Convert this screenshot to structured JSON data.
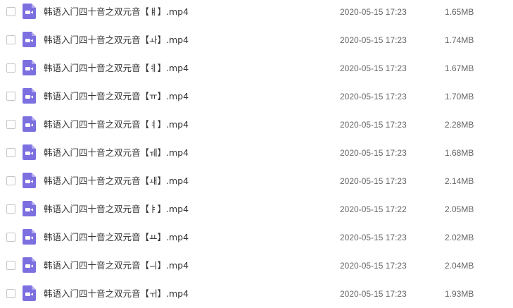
{
  "colors": {
    "video_icon": "#7c6fe0",
    "video_icon_fold": "#b6aef0",
    "checkbox_border": "#c5c5c5",
    "name_text": "#333333",
    "meta_text": "#666666"
  },
  "icon": "video-file-icon",
  "files": [
    {
      "name": "韩语入门四十音之双元音【ㅒ】.mp4",
      "date": "2020-05-15 17:23",
      "size": "1.65MB"
    },
    {
      "name": "韩语入门四十音之双元音【ㅘ】.mp4",
      "date": "2020-05-15 17:23",
      "size": "1.74MB"
    },
    {
      "name": "韩语入门四十音之双元音【ㅖ】.mp4",
      "date": "2020-05-15 17:23",
      "size": "1.67MB"
    },
    {
      "name": "韩语入门四十音之双元音【ㅠ】.mp4",
      "date": "2020-05-15 17:23",
      "size": "1.70MB"
    },
    {
      "name": "韩语入门四十音之双元音【ㅕ】.mp4",
      "date": "2020-05-15 17:23",
      "size": "2.28MB"
    },
    {
      "name": "韩语入门四十音之双元音【ㅞ】.mp4",
      "date": "2020-05-15 17:23",
      "size": "1.68MB"
    },
    {
      "name": "韩语入门四十音之双元音【ㅙ】.mp4",
      "date": "2020-05-15 17:23",
      "size": "2.14MB"
    },
    {
      "name": "韩语入门四十音之双元音【ㅑ】.mp4",
      "date": "2020-05-15 17:22",
      "size": "2.05MB"
    },
    {
      "name": "韩语入门四十音之双元音【ㅛ】.mp4",
      "date": "2020-05-15 17:23",
      "size": "2.02MB"
    },
    {
      "name": "韩语入门四十音之双元音【ㅢ】.mp4",
      "date": "2020-05-15 17:23",
      "size": "2.04MB"
    },
    {
      "name": "韩语入门四十音之双元音【ㅟ】.mp4",
      "date": "2020-05-15 17:23",
      "size": "1.93MB"
    }
  ]
}
